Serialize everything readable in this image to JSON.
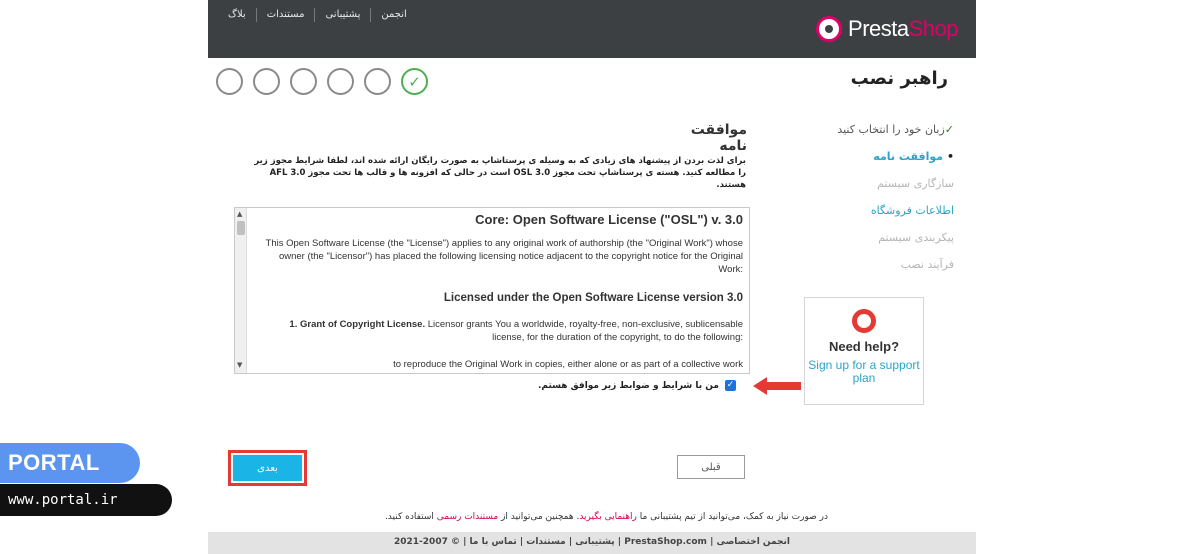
{
  "topnav": [
    "بلاگ",
    "مستندات",
    "پشتیبانی",
    "انجمن"
  ],
  "logo": {
    "part1": "Presta",
    "part2": "Shop"
  },
  "page_title": "راهبر نصب",
  "sidebar": {
    "items": [
      {
        "label": "زبان خود را انتخاب کنید",
        "state": "done",
        "mark": "✓"
      },
      {
        "label": "موافقت نامه",
        "state": "active",
        "mark": "•"
      },
      {
        "label": "سازگاری سیستم",
        "state": "pending"
      },
      {
        "label": "اطلاعات فروشگاه",
        "state": "link"
      },
      {
        "label": "پیکربندی سیستم",
        "state": "pending"
      },
      {
        "label": "فرآیند نصب",
        "state": "pending"
      }
    ]
  },
  "help_box": {
    "title": "Need help?",
    "link": "Sign up for a support plan"
  },
  "main": {
    "title": "موافقت نامه",
    "intro": "برای لذت بردن از پیشنهاد های زیادی که به وسیله ی پرستاشاپ به صورت رایگان ارائه شده اند، لطفا شرایط مجوز زیر را مطالعه کنید. هسته ی پرستاشاپ تحت مجوز OSL 3.0 است در حالی که افزونه ها و قالب ها تحت مجوز AFL 3.0 هستند."
  },
  "license": {
    "heading": "Core: Open Software License (\"OSL\") v. 3.0",
    "p1": "This Open Software License (the \"License\") applies to any original work of authorship (the \"Original Work\") whose owner (the \"Licensor\") has placed the following licensing notice adjacent to the copyright notice for the Original Work:",
    "heading2": "Licensed under the Open Software License version 3.0",
    "grant_title": "1. Grant of Copyright License.",
    "grant_body": "Licensor grants You a worldwide, royalty-free, non-exclusive, sublicensable license, for the duration of the copyright, to do the following:",
    "p3": "to reproduce the Original Work in copies, either alone or as part of a collective work"
  },
  "agree_label": "من با شرایط و ضوابط زیر موافق هستم.",
  "agree_checked": true,
  "buttons": {
    "next": "بعدی",
    "prev": "قبلی"
  },
  "help_note": {
    "prefix": "در صورت نیاز به کمک، می‌توانید از تیم پشتیبانی ما",
    "link1": "راهنمایی بگیرید",
    "middle": ". همچنین می‌توانید از",
    "link2": "مستندات رسمی",
    "suffix": "استفاده کنید."
  },
  "footer": "انجمن اختصاصی | PrestaShop.com | پشتیبانی | مستندات | تماس با ما | © 2007-2021",
  "watermark": {
    "brand": "PORTAL",
    "url": "www.portal.ir"
  },
  "colors": {
    "accent": "#2aa5c7",
    "brand_pink": "#df0067",
    "done_green": "#4caf50",
    "highlight_red": "#e53935"
  }
}
